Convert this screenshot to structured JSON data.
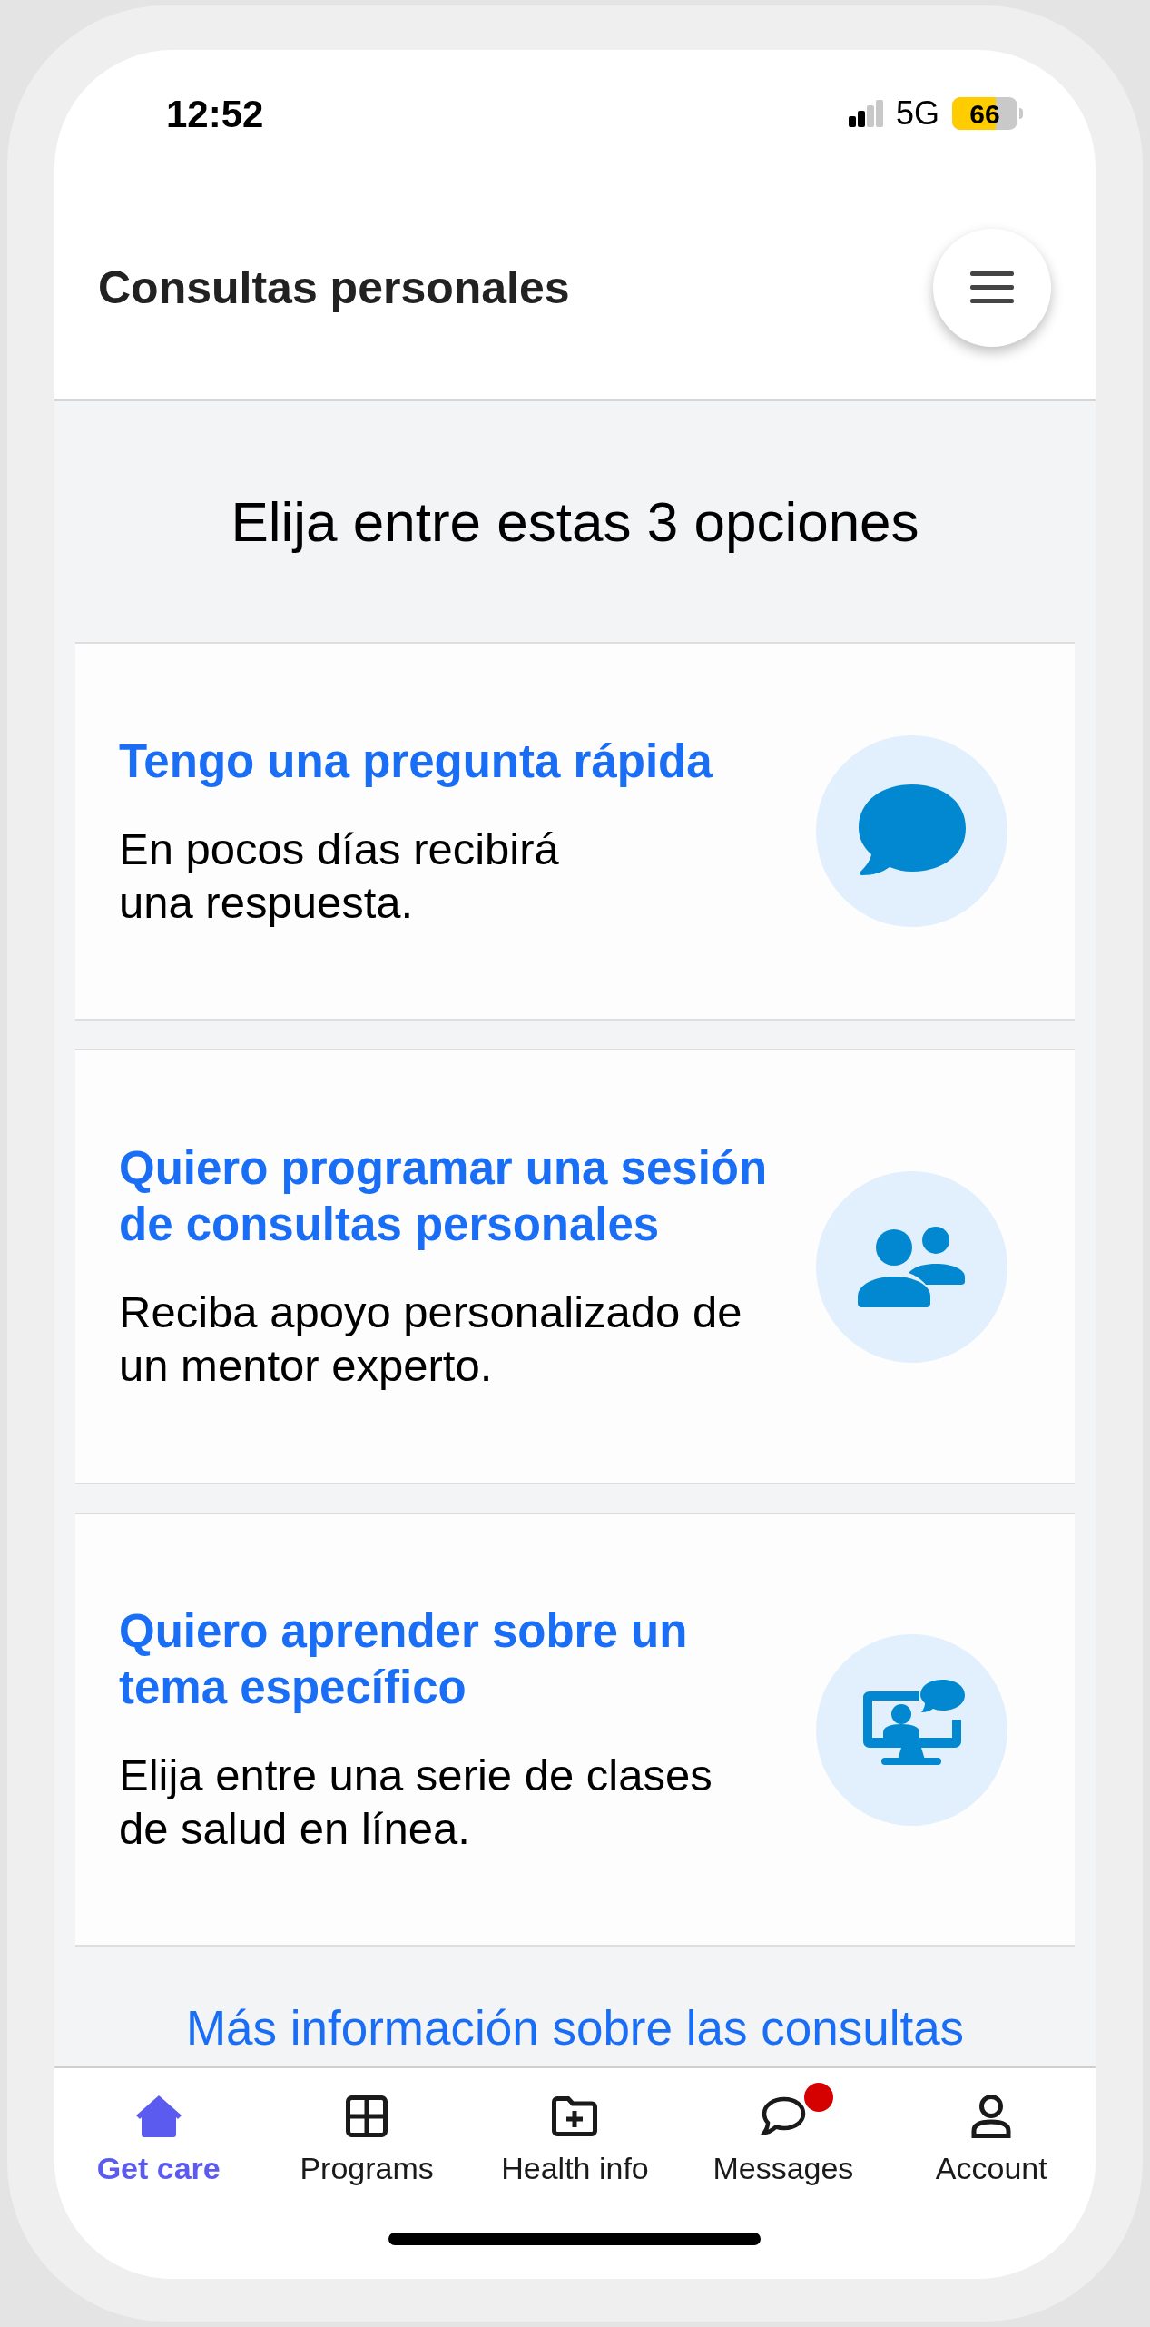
{
  "status_bar": {
    "time": "12:52",
    "network": "5G",
    "battery": "66"
  },
  "header": {
    "title": "Consultas personales"
  },
  "heading": "Elija entre estas 3 opciones",
  "options": [
    {
      "title": "Tengo una pregunta rápida",
      "description_lines": [
        "En pocos días recibirá",
        "una respuesta."
      ]
    },
    {
      "title": "Quiero programar una sesión de consultas personales",
      "description_lines": [
        "Reciba apoyo personalizado de",
        "un mentor experto."
      ]
    },
    {
      "title": "Quiero aprender sobre un tema específico",
      "description_lines": [
        "Elija entre una serie de clases",
        "de salud en línea."
      ]
    }
  ],
  "link": "Más información sobre las consultas",
  "tabs": [
    {
      "label": "Get care",
      "selected": true,
      "notification": false
    },
    {
      "label": "Programs",
      "selected": false,
      "notification": false
    },
    {
      "label": "Health info",
      "selected": false,
      "notification": false
    },
    {
      "label": "Messages",
      "selected": false,
      "notification": true
    },
    {
      "label": "Account",
      "selected": false,
      "notification": false
    }
  ]
}
